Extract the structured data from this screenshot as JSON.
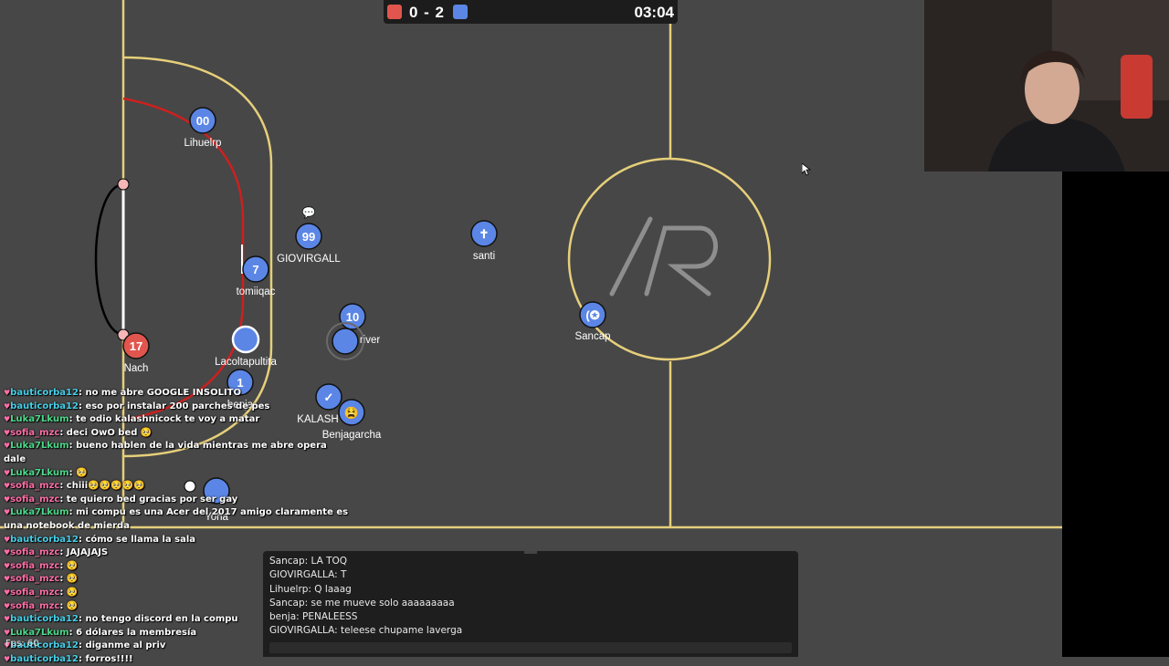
{
  "scoreboard": {
    "red_color": "#e0564e",
    "blue_color": "#5b86e6",
    "score": "0 - 2",
    "timer": "03:04"
  },
  "field": {
    "background": "#474747",
    "line_color": "#e6cf7a",
    "logo_text": "/R",
    "goal_area_red_line": "#cc2020"
  },
  "players": [
    {
      "name": "Lihuelrp",
      "avatar": "00",
      "team": "blue"
    },
    {
      "name": "GIOVIRGALL",
      "avatar": "99",
      "team": "blue"
    },
    {
      "name": "santi",
      "avatar": "✝",
      "team": "blue"
    },
    {
      "name": "tomiiqac",
      "avatar": "7",
      "team": "blue"
    },
    {
      "name": "Ju",
      "avatar": "10",
      "team": "blue"
    },
    {
      "name": "river",
      "avatar": "",
      "team": "blue"
    },
    {
      "name": "Sancap",
      "avatar": "(✪",
      "team": "blue"
    },
    {
      "name": "Nach",
      "avatar": "17",
      "team": "red"
    },
    {
      "name": "Lacoltapultita",
      "avatar": "",
      "team": "blue"
    },
    {
      "name": "benja",
      "avatar": "1",
      "team": "blue"
    },
    {
      "name": "KALASH",
      "avatar": "✓",
      "team": "blue"
    },
    {
      "name": "Benjagarcha",
      "avatar": "😫",
      "team": "blue"
    },
    {
      "name": "Yoha",
      "avatar": "",
      "team": "blue"
    }
  ],
  "chat_bubble": "💬",
  "stream_chat": [
    {
      "user": "bauticorba12",
      "msg": "no me abre GOOGLE INSOLITO"
    },
    {
      "user": "bauticorba12",
      "msg": "eso por instalar 200 parches de pes"
    },
    {
      "user": "Luka7Lkum",
      "msg": "te odio kalashnicock te voy a matar"
    },
    {
      "user": "sofia_mzc",
      "msg": "deci OwO bed 🥺"
    },
    {
      "user": "Luka7Lkum",
      "msg": "bueno hablen de la vida mientras me abre opera dale"
    },
    {
      "user": "Luka7Lkum",
      "msg": "🥺"
    },
    {
      "user": "sofia_mzc",
      "msg": "chiii🥺🥺🥺🥺🥺"
    },
    {
      "user": "sofia_mzc",
      "msg": "te quiero bed gracias por ser gay"
    },
    {
      "user": "Luka7Lkum",
      "msg": "mi compu es una Acer del 2017 amigo claramente es una notebook de mierda"
    },
    {
      "user": "bauticorba12",
      "msg": "cómo se llama la sala"
    },
    {
      "user": "sofia_mzc",
      "msg": "JAJAJAJS"
    },
    {
      "user": "sofia_mzc",
      "msg": "🥺"
    },
    {
      "user": "sofia_mzc",
      "msg": "🥺"
    },
    {
      "user": "sofia_mzc",
      "msg": "🥺"
    },
    {
      "user": "sofia_mzc",
      "msg": "🥺"
    },
    {
      "user": "bauticorba12",
      "msg": "no tengo discord en la compu"
    },
    {
      "user": "Luka7Lkum",
      "msg": "6 dólares la membresía"
    },
    {
      "user": "bauticorba12",
      "msg": "diganme al priv"
    },
    {
      "user": "bauticorba12",
      "msg": "forros!!!!"
    }
  ],
  "fps_label": "Fps: 60",
  "game_chat": [
    "Sancap: LA TOQ",
    "GIOVIRGALLA: T",
    "Lihuelrp: Q laaag",
    "Sancap: se me mueve solo aaaaaaaaa",
    "benja: PENALEESS",
    "GIOVIRGALLA: teleese chupame laverga"
  ],
  "game_chat_input_placeholder": ""
}
